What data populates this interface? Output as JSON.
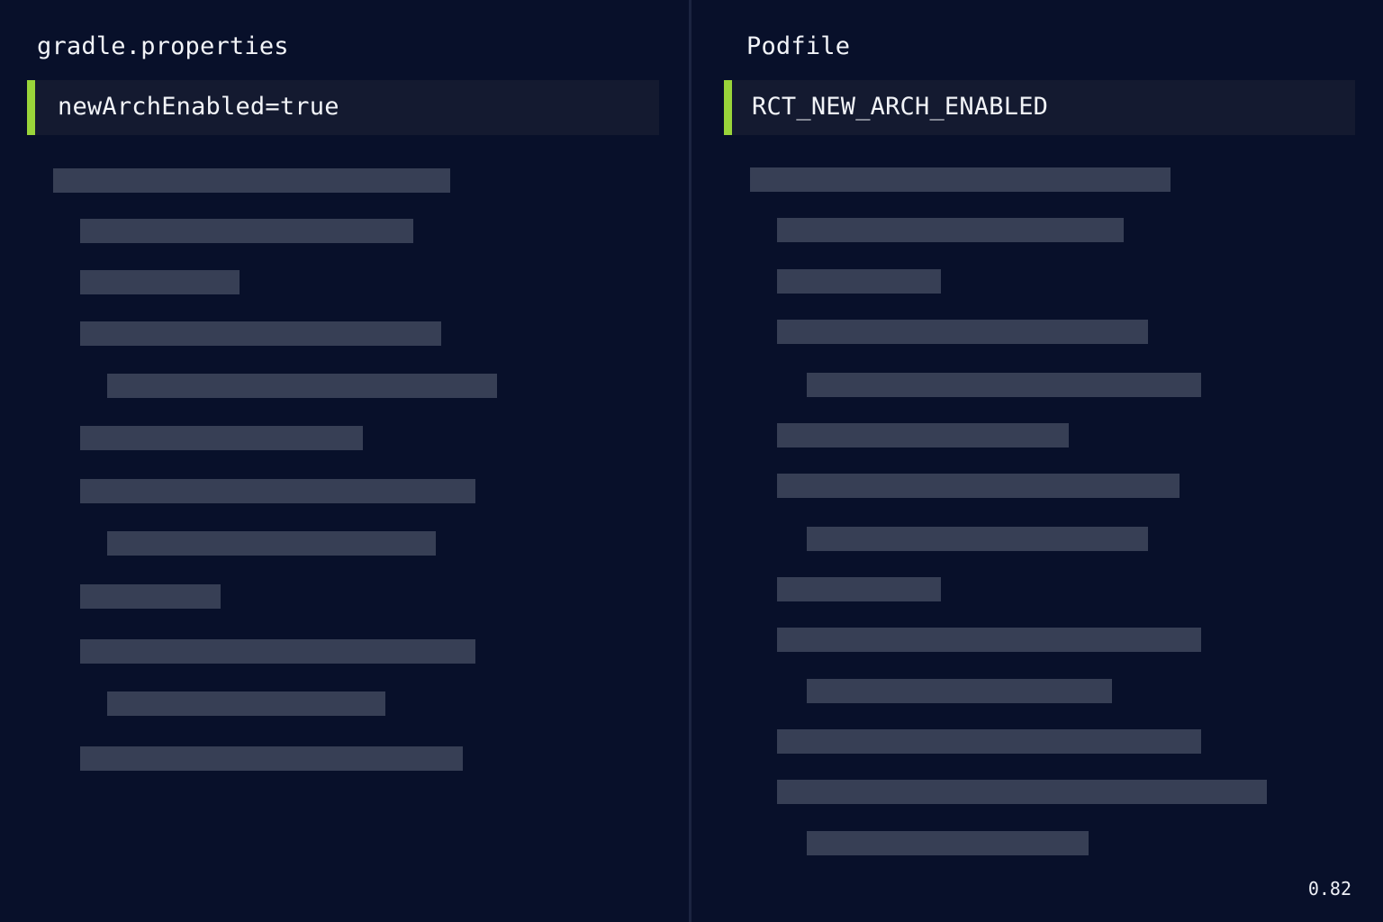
{
  "left_pane": {
    "title": "gradle.properties",
    "highlighted_line": "newArchEnabled=true",
    "accent_color": "#9ad53a"
  },
  "right_pane": {
    "title": "Podfile",
    "highlighted_line": "RCT_NEW_ARCH_ENABLED",
    "accent_color": "#9ad53a"
  },
  "score": "0.82",
  "colors": {
    "background": "#08102a",
    "placeholder_line": "#373f55",
    "highlight_background": "#141a30"
  }
}
